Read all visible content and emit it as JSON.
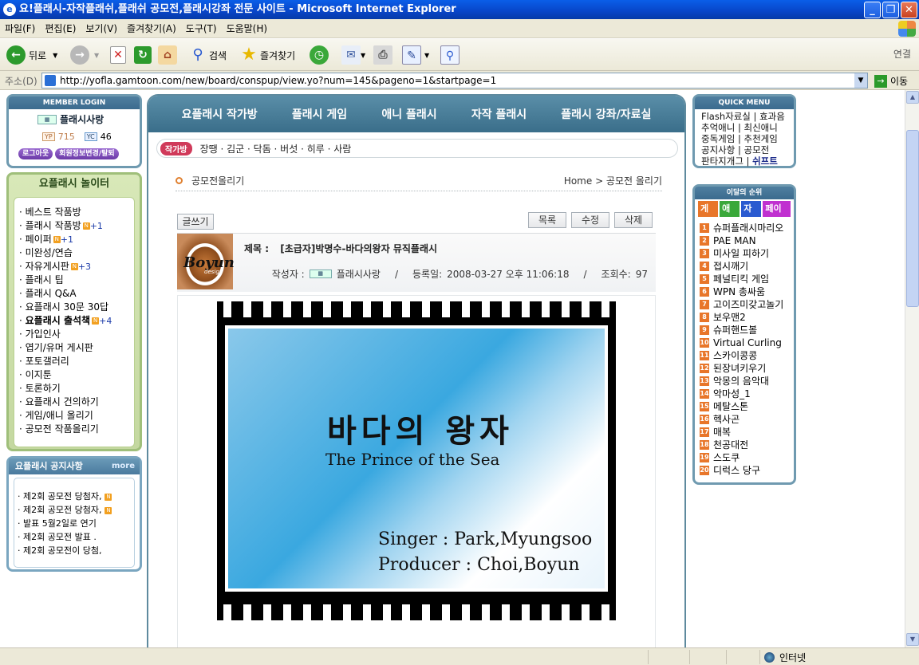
{
  "window": {
    "title": "요!플래시-자작플래쉬,플래쉬 공모전,플래시강좌 전문 사이트 - Microsoft Internet Explorer"
  },
  "menu": [
    "파일(F)",
    "편집(E)",
    "보기(V)",
    "즐겨찾기(A)",
    "도구(T)",
    "도움말(H)"
  ],
  "toolbar": {
    "back": "뒤로",
    "search": "검색",
    "favorites": "즐겨찾기",
    "links": "연결"
  },
  "address": {
    "label": "주소(D)",
    "url": "http://yofla.gamtoon.com/new/board/conspup/view.yo?num=145&pageno=1&startpage=1",
    "go": "이동"
  },
  "login": {
    "header": "MEMBER LOGIN",
    "user": "플래시사랑",
    "yp_label": "YP",
    "yp": "715",
    "yc_label": "YC",
    "yc": "46",
    "logout": "로그아웃",
    "edit": "회원정보변경/탈퇴"
  },
  "play": {
    "header": "요플래시 놀이터",
    "items": [
      {
        "label": "베스트 작품방",
        "badge": "",
        "count": ""
      },
      {
        "label": "플래시 작품방",
        "badge": "N",
        "count": "+1"
      },
      {
        "label": "페이퍼",
        "badge": "N",
        "count": "+1"
      },
      {
        "label": "미완성/연습",
        "badge": "",
        "count": ""
      },
      {
        "label": "자유게시판",
        "badge": "N",
        "count": "+3"
      },
      {
        "label": "플래시 팁",
        "badge": "",
        "count": ""
      },
      {
        "label": "플래시 Q&A",
        "badge": "",
        "count": ""
      },
      {
        "label": "요플래시 30문 30답",
        "badge": "",
        "count": ""
      },
      {
        "label": "요플래시 출석책",
        "badge": "N",
        "count": "+4"
      },
      {
        "label": "가입인사",
        "badge": "",
        "count": ""
      },
      {
        "label": "엽기/유머 게시판",
        "badge": "",
        "count": ""
      },
      {
        "label": "포토갤러리",
        "badge": "",
        "count": ""
      },
      {
        "label": "이지툰",
        "badge": "",
        "count": ""
      },
      {
        "label": "토론하기",
        "badge": "",
        "count": ""
      },
      {
        "label": "요플래시 건의하기",
        "badge": "",
        "count": ""
      },
      {
        "label": "게임/애니 올리기",
        "badge": "",
        "count": ""
      },
      {
        "label": "공모전 작품올리기",
        "badge": "",
        "count": ""
      }
    ]
  },
  "notice": {
    "header": "요플래시 공지사항",
    "more": "more",
    "items": [
      "제2회 공모전 당첨자,",
      "제2회 공모전 당첨자,",
      "발표 5월2일로 연기",
      "제2회 공모전 발표 .",
      "제2회 공모전이 당첨,"
    ]
  },
  "nav": [
    "요플래시 작가방",
    "플래시 게임",
    "애니 플래시",
    "자작 플래시",
    "플래시 강좌/자료실"
  ],
  "tagbar": {
    "badge": "작가방",
    "names": "장땡 · 김군 · 닥돔 · 버섯 · 히루 · 사람"
  },
  "crumbs": {
    "title": "공모전올리기",
    "path": "Home > 공모전 올리기"
  },
  "buttons": {
    "write": "글쓰기",
    "list": "목록",
    "edit": "수정",
    "delete": "삭제"
  },
  "post": {
    "title_label": "제목 :",
    "title": "[초급자]박명수-바다의왕자 뮤직플래시",
    "author_label": "작성자 :",
    "author": "플래시사랑",
    "date_label": "등록일:",
    "date": "2008-03-27 오후 11:06:18",
    "views_label": "조회수:",
    "views": "97",
    "avatar_text": "Boyun",
    "avatar_sub": "design"
  },
  "video": {
    "title_ko": "바다의 왕자",
    "title_en": "The Prince of the Sea",
    "singer": "Singer : Park,Myungsoo",
    "producer": "Producer : Choi,Boyun"
  },
  "quick": {
    "header": "QUICK MENU",
    "lines": [
      "Flash자료실 | 효과음",
      "추억애니 | 최신애니",
      "중독게임 | 추천게임",
      "공지사항 | 공모전"
    ],
    "last1": "판타지개그 | ",
    "last2": "쉬프트"
  },
  "rank": {
    "header": "이달의 순위",
    "tabs": [
      "게임",
      "애니",
      "자작",
      "페이퍼"
    ],
    "tab_colors": [
      "#e8762a",
      "#3aa83a",
      "#2a5ad0",
      "#c030d0"
    ],
    "items": [
      "슈퍼플래시마리오",
      "PAE MAN",
      "미사일 피하기",
      "접시깨기",
      "페널티킥 게임",
      "WPN 총싸움",
      "고이즈미갖고놀기",
      "보우맨2",
      "슈퍼핸드볼",
      "Virtual Curling",
      "스카이콩콩",
      "된장녀키우기",
      "악몽의 음악대",
      "악마성_1",
      "메탈스톤",
      "헥사곤",
      "매복",
      "천공대전",
      "스도쿠",
      "디럭스 당구"
    ]
  },
  "status": {
    "zone": "인터넷"
  }
}
